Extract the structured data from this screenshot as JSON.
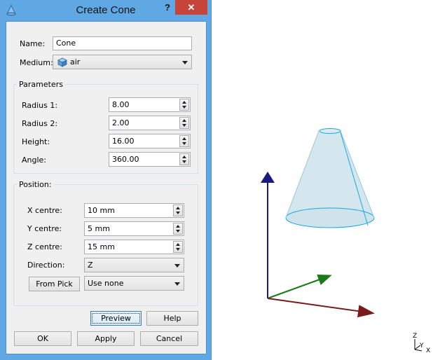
{
  "dialog": {
    "title": "Create Cone",
    "help_button": "?",
    "close_button": "✕",
    "name_label": "Name:",
    "name_value": "Cone",
    "medium_label": "Medium:",
    "medium_value": "air",
    "parameters": {
      "title": "Parameters",
      "radius1_label": "Radius 1:",
      "radius1_value": "8.00",
      "radius2_label": "Radius 2:",
      "radius2_value": "2.00",
      "height_label": "Height:",
      "height_value": "16.00",
      "angle_label": "Angle:",
      "angle_value": "360.00"
    },
    "position": {
      "title": "Position:",
      "x_label": "X centre:",
      "x_value": "10 mm",
      "y_label": "Y centre:",
      "y_value": "5 mm",
      "z_label": "Z centre:",
      "z_value": "15 mm",
      "direction_label": "Direction:",
      "direction_value": "Z",
      "from_pick_label": "From Pick",
      "pick_value": "Use none"
    },
    "buttons": {
      "preview": "Preview",
      "help": "Help",
      "ok": "OK",
      "apply": "Apply",
      "cancel": "Cancel"
    }
  },
  "viewport": {
    "mini_axes": {
      "z": "Z",
      "y": "Y",
      "x": "X"
    },
    "colors": {
      "cone_fill": "#d4e6ee",
      "cone_edge": "#1aa8e0",
      "axis_z": "#1a1a80",
      "axis_y": "#1a7a1a",
      "axis_x": "#7a1a1a"
    }
  }
}
